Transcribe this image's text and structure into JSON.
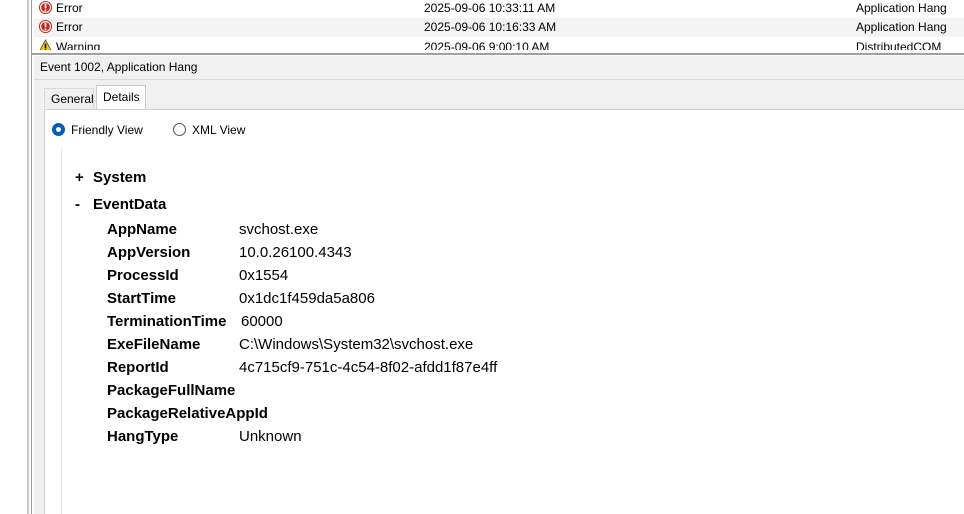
{
  "event_list": {
    "rows": [
      {
        "level": "Error",
        "datetime": "2025-09-06 10:33:11 AM",
        "source": "Application Hang",
        "icon": "error-icon"
      },
      {
        "level": "Error",
        "datetime": "2025-09-06 10:16:33 AM",
        "source": "Application Hang",
        "icon": "error-icon"
      },
      {
        "level": "Warning",
        "datetime": "2025-09-06 9:00:10 AM",
        "source": "DistributedCOM",
        "icon": "warning-icon"
      }
    ]
  },
  "detail": {
    "title": "Event 1002, Application Hang",
    "tabs": [
      {
        "label": "General"
      },
      {
        "label": "Details"
      }
    ],
    "view_options": {
      "friendly": "Friendly View",
      "xml": "XML View",
      "selected": "friendly"
    },
    "tree": {
      "system": {
        "toggle": "+",
        "label": "System"
      },
      "eventdata": {
        "toggle": "-",
        "label": "EventData",
        "fields": [
          {
            "key": "AppName",
            "value": "svchost.exe"
          },
          {
            "key": "AppVersion",
            "value": "10.0.26100.4343"
          },
          {
            "key": "ProcessId",
            "value": "0x1554"
          },
          {
            "key": "StartTime",
            "value": "0x1dc1f459da5a806"
          },
          {
            "key": "TerminationTime",
            "value": "60000"
          },
          {
            "key": "ExeFileName",
            "value": "C:\\Windows\\System32\\svchost.exe"
          },
          {
            "key": "ReportId",
            "value": "4c715cf9-751c-4c54-8f02-afdd1f87e4ff"
          },
          {
            "key": "PackageFullName",
            "value": ""
          },
          {
            "key": "PackageRelativeAppId",
            "value": ""
          },
          {
            "key": "HangType",
            "value": "Unknown"
          }
        ]
      }
    }
  },
  "colors": {
    "error": "#c42b1c",
    "warning": "#f7c600",
    "radio_selected": "#005fb8"
  }
}
